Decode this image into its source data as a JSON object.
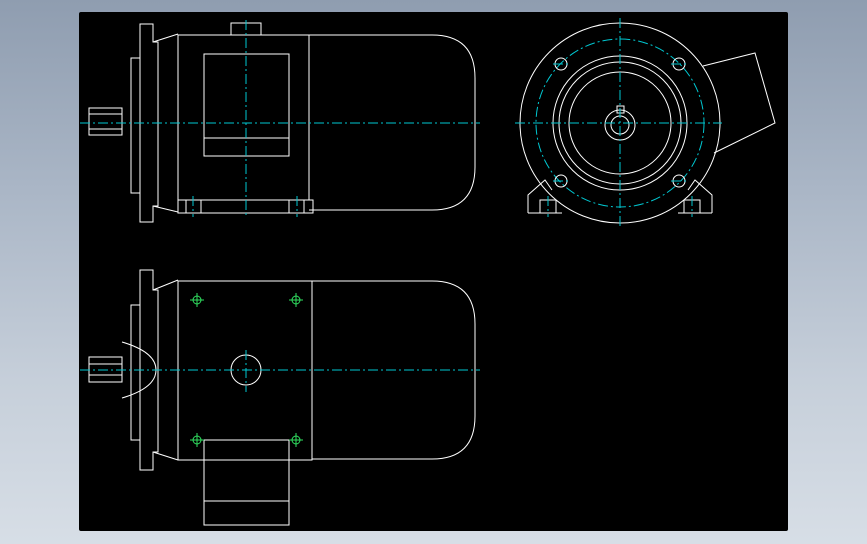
{
  "viewer": {
    "title": "",
    "background_color": "#000000",
    "line_color": "#ffffff",
    "centerline_color": "#00c8d2",
    "hole_marker_color": "#30e060"
  },
  "drawing": {
    "views": [
      "side-view-top",
      "front-view",
      "side-view-bottom"
    ],
    "annotations": []
  }
}
